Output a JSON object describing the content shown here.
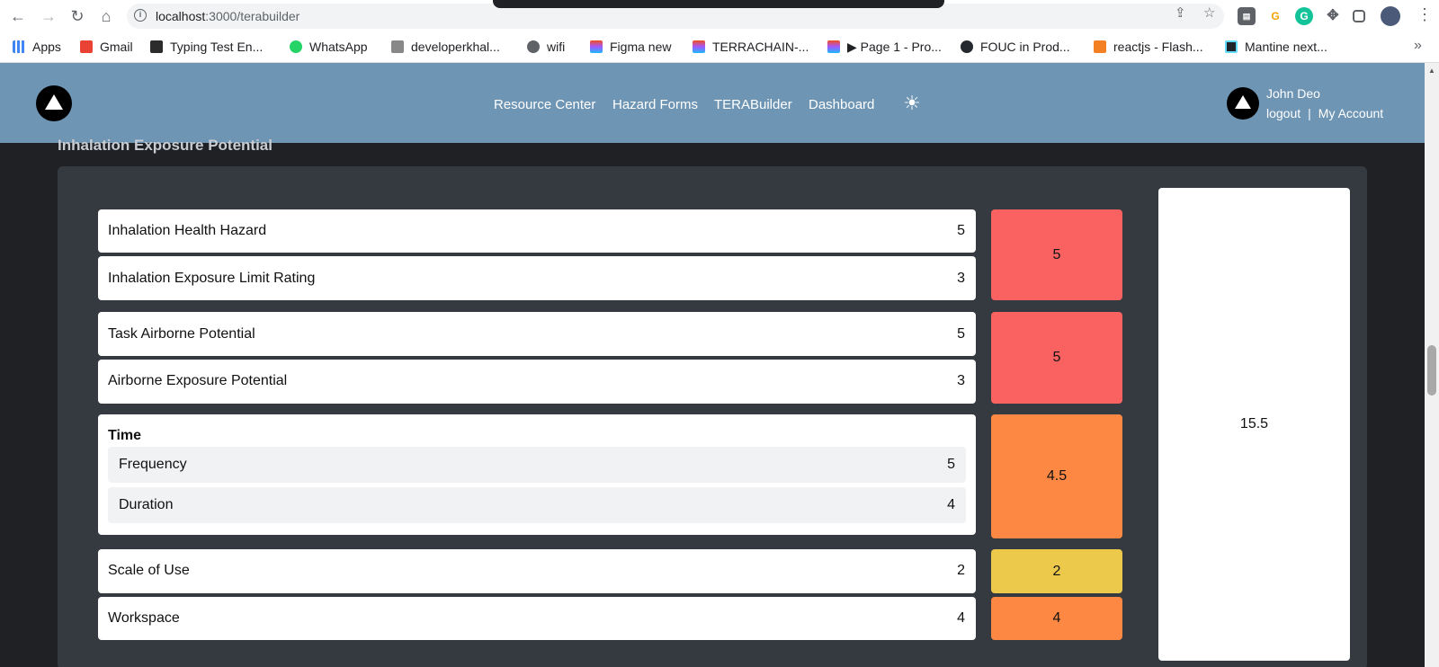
{
  "browser": {
    "url_host": "localhost",
    "url_port_path": ":3000/terabuilder",
    "bookmarks": [
      {
        "label": "Apps",
        "color": "#4285f4"
      },
      {
        "label": "Gmail",
        "color": "#ea4335"
      },
      {
        "label": "Typing Test En...",
        "color": "#2b2b2b"
      },
      {
        "label": "WhatsApp",
        "color": "#25d366"
      },
      {
        "label": "developerkhal...",
        "color": "#888888"
      },
      {
        "label": "wifi",
        "color": "#5f6368"
      },
      {
        "label": "Figma new",
        "color": "#f24e1e"
      },
      {
        "label": "TERRACHAIN-...",
        "color": "#f24e1e"
      },
      {
        "label": "▶ Page 1 - Pro...",
        "color": "#f24e1e"
      },
      {
        "label": "FOUC in Prod...",
        "color": "#24292f"
      },
      {
        "label": "reactjs - Flash...",
        "color": "#f48024"
      },
      {
        "label": "Mantine next...",
        "color": "#61dafb"
      }
    ]
  },
  "header": {
    "nav": [
      "Resource Center",
      "Hazard Forms",
      "TERABuilder",
      "Dashboard"
    ],
    "user_name": "John Deo",
    "logout": "logout",
    "separator": "|",
    "my_account": "My Account"
  },
  "section": {
    "title": "Inhalation Exposure Potential",
    "rows": {
      "inhalation_health_hazard": {
        "label": "Inhalation Health Hazard",
        "value": "5"
      },
      "inhalation_exposure_limit": {
        "label": "Inhalation Exposure Limit Rating",
        "value": "3"
      },
      "task_airborne": {
        "label": "Task Airborne Potential",
        "value": "5"
      },
      "airborne_exposure": {
        "label": "Airborne Exposure Potential",
        "value": "3"
      },
      "scale_of_use": {
        "label": "Scale of Use",
        "value": "2"
      },
      "workspace": {
        "label": "Workspace",
        "value": "4"
      }
    },
    "time": {
      "title": "Time",
      "frequency": {
        "label": "Frequency",
        "value": "5"
      },
      "duration": {
        "label": "Duration",
        "value": "4"
      }
    },
    "scores": {
      "group1": {
        "value": "5",
        "color": "#fa6262"
      },
      "group2": {
        "value": "5",
        "color": "#fa6262"
      },
      "time": {
        "value": "4.5",
        "color": "#fd8844"
      },
      "scale_of_use": {
        "value": "2",
        "color": "#ecc94b"
      },
      "workspace": {
        "value": "4",
        "color": "#fd8844"
      }
    },
    "total": "15.5"
  },
  "colors": {
    "header_bg": "#6f95b4",
    "page_bg": "#1f2125",
    "panel_bg": "#353940"
  }
}
